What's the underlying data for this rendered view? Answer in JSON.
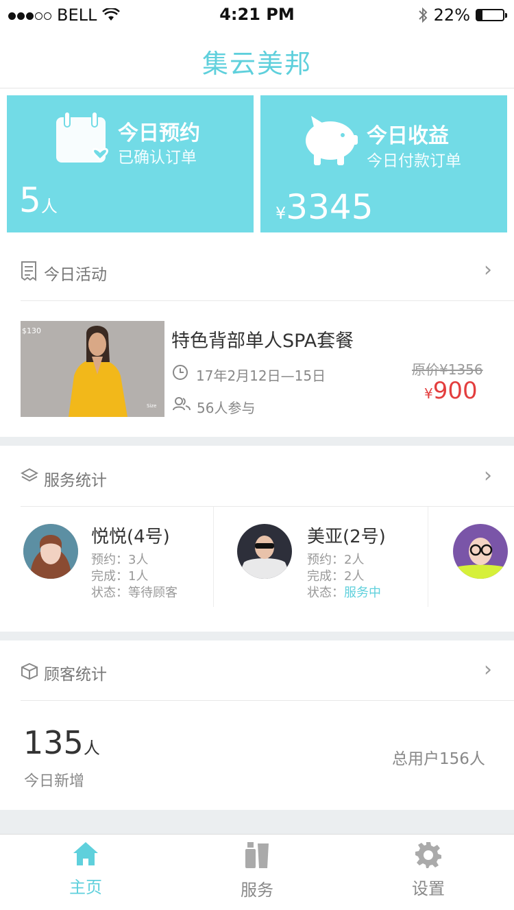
{
  "status_bar": {
    "carrier": "BELL",
    "time": "4:21 PM",
    "battery": "22%"
  },
  "header": {
    "logo": "集云美邦"
  },
  "cards": {
    "appointments": {
      "title": "今日预约",
      "subtitle": "已确认订单",
      "value": "5",
      "unit": "人"
    },
    "revenue": {
      "title": "今日收益",
      "subtitle": "今日付款订单",
      "currency": "¥",
      "value": "3345"
    }
  },
  "activity": {
    "section_title": "今日活动",
    "item": {
      "image_tag": "$130",
      "image_tag2": "Size",
      "name": "特色背部单人SPA套餐",
      "date": "17年2月12日—15日",
      "participants": "56人参与",
      "original_price": "原价¥1356",
      "currency": "¥",
      "price": "900"
    }
  },
  "service_stats": {
    "section_title": "服务统计",
    "staff": [
      {
        "name": "悦悦(4号)",
        "booked_label": "预约：",
        "booked": "3人",
        "done_label": "完成：",
        "done": "1人",
        "state_label": "状态：",
        "state": "等待顾客"
      },
      {
        "name": "美亚(2号)",
        "booked_label": "预约：",
        "booked": "2人",
        "done_label": "完成：",
        "done": "2人",
        "state_label": "状态：",
        "state": "服务中"
      }
    ]
  },
  "customer_stats": {
    "section_title": "顾客统计",
    "new_value": "135",
    "new_unit": "人",
    "new_label": "今日新增",
    "total": "总用户156人"
  },
  "tabbar": {
    "tabs": [
      {
        "label": "主页",
        "active": true
      },
      {
        "label": "服务",
        "active": false
      },
      {
        "label": "设置",
        "active": false
      }
    ]
  },
  "colors": {
    "accent": "#72dbe6",
    "price": "#e33e3e",
    "active_tab": "#5fd0dc"
  }
}
